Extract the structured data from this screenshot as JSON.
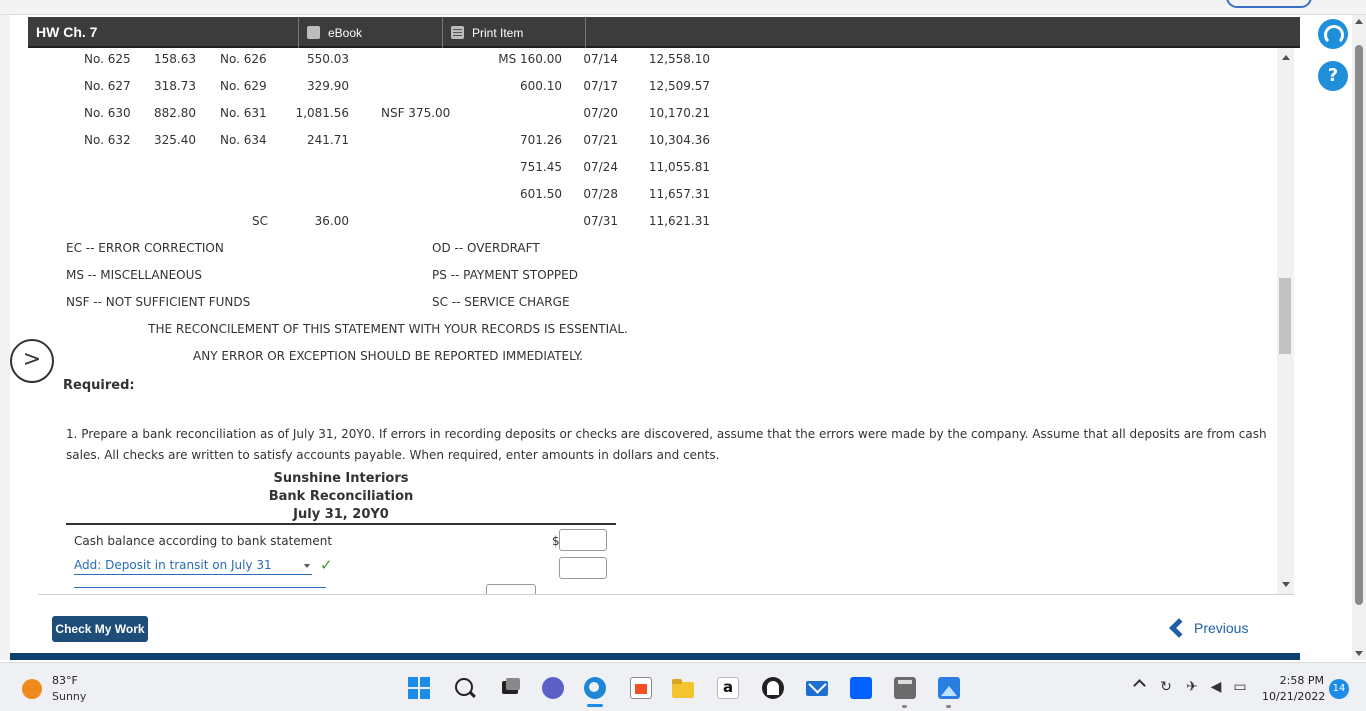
{
  "header": {
    "title": "HW Ch. 7",
    "tab_ebook": "eBook",
    "tab_print": "Print Item"
  },
  "statement": {
    "rows": [
      {
        "c1": "No. 625",
        "a1": "158.63",
        "c2": "No. 626",
        "a2": "550.03",
        "note": "",
        "deposit": "MS 160.00",
        "date": "07/14",
        "balance": "12,558.10"
      },
      {
        "c1": "No. 627",
        "a1": "318.73",
        "c2": "No. 629",
        "a2": "329.90",
        "note": "",
        "deposit": "600.10",
        "date": "07/17",
        "balance": "12,509.57"
      },
      {
        "c1": "No. 630",
        "a1": "882.80",
        "c2": "No. 631",
        "a2": "1,081.56",
        "note": "NSF 375.00",
        "deposit": "",
        "date": "07/20",
        "balance": "10,170.21"
      },
      {
        "c1": "No. 632",
        "a1": "325.40",
        "c2": "No. 634",
        "a2": "241.71",
        "note": "",
        "deposit": "701.26",
        "date": "07/21",
        "balance": "10,304.36"
      },
      {
        "c1": "",
        "a1": "",
        "c2": "",
        "a2": "",
        "note": "",
        "deposit": "751.45",
        "date": "07/24",
        "balance": "11,055.81"
      },
      {
        "c1": "",
        "a1": "",
        "c2": "",
        "a2": "",
        "note": "",
        "deposit": "601.50",
        "date": "07/28",
        "balance": "11,657.31"
      },
      {
        "c1": "",
        "a1": "",
        "c2": "SC",
        "a2": "36.00",
        "note": "",
        "deposit": "",
        "date": "07/31",
        "balance": "11,621.31"
      }
    ],
    "legend": [
      {
        "left": "EC -- ERROR CORRECTION",
        "right": "OD -- OVERDRAFT"
      },
      {
        "left": "MS -- MISCELLANEOUS",
        "right": "PS -- PAYMENT STOPPED"
      },
      {
        "left": "NSF -- NOT SUFFICIENT FUNDS",
        "right": "SC -- SERVICE CHARGE"
      }
    ],
    "notice_1": "THE RECONCILEMENT OF THIS STATEMENT WITH YOUR RECORDS IS ESSENTIAL.",
    "notice_2": "ANY ERROR OR EXCEPTION SHOULD BE REPORTED IMMEDIATELY."
  },
  "question": {
    "required_label": "Required:",
    "instruction": "1. Prepare a bank reconciliation as of July 31, 20Y0. If errors in recording deposits or checks are discovered, assume that the errors were made by the company. Assume that all deposits are from cash sales. All checks are written to satisfy accounts payable. When required, enter amounts in dollars and cents."
  },
  "reconciliation": {
    "company": "Sunshine Interiors",
    "title": "Bank Reconciliation",
    "date": "July 31, 20Y0",
    "line_1_label": "Cash balance according to bank statement",
    "currency_symbol": "$",
    "line_2_selected": "Add: Deposit in transit on July 31",
    "line_2_check": "✓",
    "line_1_value": "",
    "line_2_value": ""
  },
  "actions": {
    "check_work": "Check My Work",
    "previous": "Previous"
  },
  "nav": {
    "next_arrow": ">",
    "help": "?"
  },
  "taskbar": {
    "temperature": "83°F",
    "weather": "Sunny",
    "amazon_glyph": "a",
    "time": "2:58 PM",
    "date": "10/21/2022",
    "notification_count": "14"
  },
  "colors": {
    "header_bg": "#3c3c3c",
    "check_button": "#1f4d7a",
    "previous_link": "#1f5fa8",
    "accent_blue": "#1d8ce6",
    "valid_green": "#3a9a2a"
  }
}
